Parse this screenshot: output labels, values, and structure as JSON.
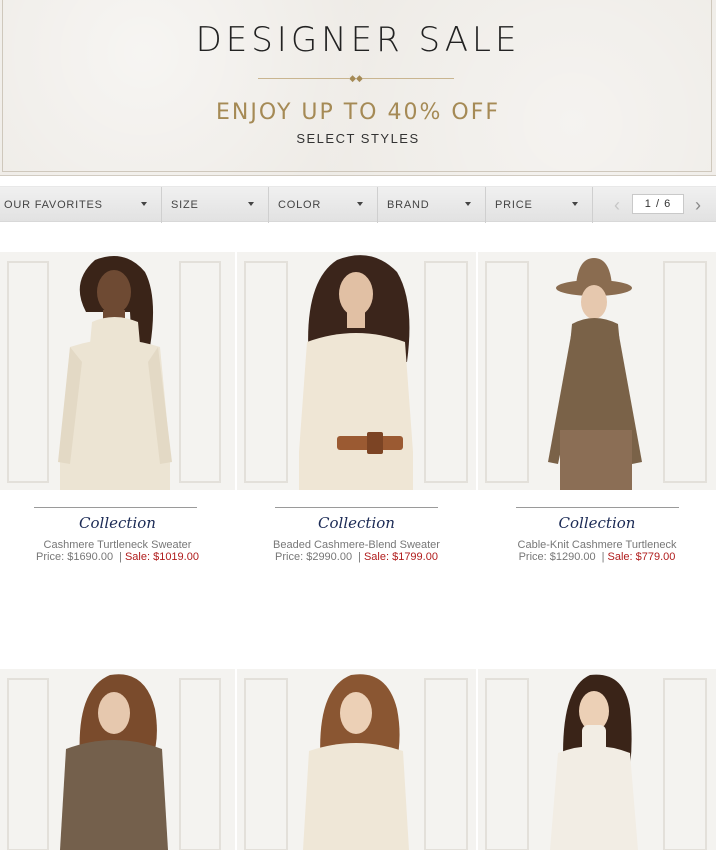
{
  "hero": {
    "title": "DESIGNER SALE",
    "subtitle": "ENJOY UP TO 40% OFF",
    "note": "SELECT STYLES"
  },
  "filters": [
    {
      "label": "OUR FAVORITES"
    },
    {
      "label": "SIZE"
    },
    {
      "label": "COLOR"
    },
    {
      "label": "BRAND"
    },
    {
      "label": "PRICE"
    }
  ],
  "pager": {
    "current": "1 / 6"
  },
  "products": [
    {
      "brand": "Collection",
      "name": "Cashmere Turtleneck Sweater",
      "price": "Price: $1690.00",
      "sale": "Sale: $1019.00",
      "sweater_color": "#ece4d3"
    },
    {
      "brand": "Collection",
      "name": "Beaded Cashmere-Blend Sweater",
      "price": "Price: $2990.00",
      "sale": "Sale: $1799.00",
      "sweater_color": "#efe6d5"
    },
    {
      "brand": "Collection",
      "name": "Cable-Knit Cashmere Turtleneck",
      "price": "Price: $1290.00",
      "sale": "Sale: $779.00",
      "sweater_color": "#7a6248"
    },
    {
      "sweater_color": "#74604c"
    },
    {
      "sweater_color": "#efe7d7"
    },
    {
      "sweater_color": "#f2ede4"
    }
  ],
  "colors": {
    "accent_gold": "#a58a55",
    "brand_navy": "#1b2a55",
    "sale_red": "#b01c1c"
  }
}
